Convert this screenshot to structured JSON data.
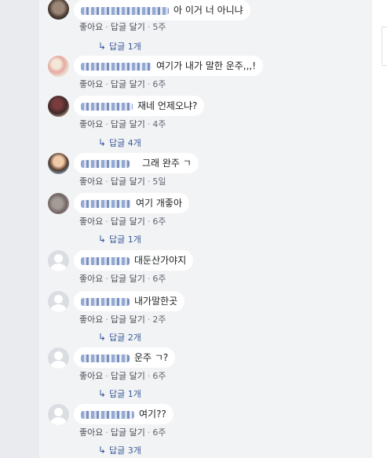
{
  "labels": {
    "like": "좋아요",
    "reply": "답글 달기",
    "separator": "·"
  },
  "comments": [
    {
      "text": "아 이거 너 아니냐",
      "time": "5주",
      "replies": "답글 1개"
    },
    {
      "text": "여기가 내가 말한 운주,,,!",
      "time": "6주",
      "replies": ""
    },
    {
      "text": "재네 언제오냐?",
      "time": "4주",
      "replies": "답글 4개"
    },
    {
      "text": "그래 완주 ㄱ",
      "time": "5일",
      "replies": ""
    },
    {
      "text": "여기 개좋아",
      "time": "6주",
      "replies": "답글 1개"
    },
    {
      "text": "대둔산가야지",
      "time": "6주",
      "replies": ""
    },
    {
      "text": "내가말한곳",
      "time": "2주",
      "replies": "답글 2개"
    },
    {
      "text": "운주 ㄱ?",
      "time": "6주",
      "replies": "답글 1개"
    },
    {
      "text": "여기??",
      "time": "6주",
      "replies": "답글 3개"
    }
  ]
}
